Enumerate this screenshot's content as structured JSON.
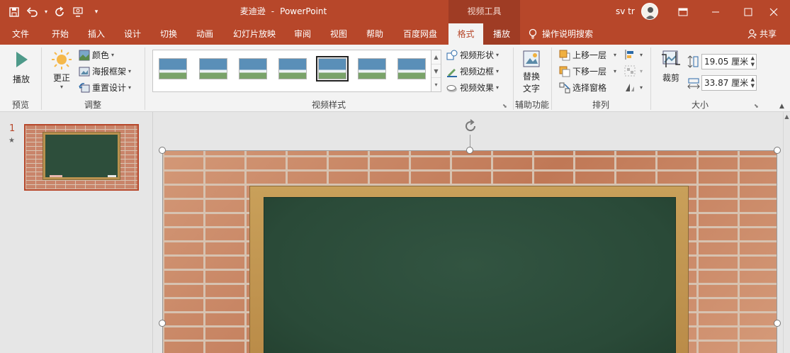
{
  "titlebar": {
    "filename": "麦迪逊",
    "separator": "-",
    "app": "PowerPoint",
    "context_header": "视频工具",
    "user": "sv tr",
    "qat": {
      "save": "save-icon",
      "undo": "undo-icon",
      "redo": "redo-icon",
      "touch": "touch-mode-icon",
      "customize": "customize-qat-icon"
    }
  },
  "tabs": [
    "文件",
    "开始",
    "插入",
    "设计",
    "切换",
    "动画",
    "幻灯片放映",
    "审阅",
    "视图",
    "帮助",
    "百度网盘",
    "格式",
    "播放"
  ],
  "active_tab": "格式",
  "tell_me": "操作说明搜索",
  "share": "共享",
  "ribbon": {
    "preview": {
      "play": "播放",
      "label": "预览"
    },
    "adjust": {
      "corrections": "更正",
      "color": "颜色",
      "poster_frame": "海报框架",
      "reset_design": "重置设计",
      "label": "调整"
    },
    "styles": {
      "label": "视频样式",
      "video_shape": "视频形状",
      "video_border": "视频边框",
      "video_effects": "视频效果"
    },
    "accessibility": {
      "alt_text_1": "替换",
      "alt_text_2": "文字",
      "label": "辅助功能"
    },
    "arrange": {
      "bring_forward": "上移一层",
      "send_backward": "下移一层",
      "selection_pane": "选择窗格",
      "label": "排列"
    },
    "size": {
      "crop": "裁剪",
      "height": "19.05 厘米",
      "width": "33.87 厘米",
      "label": "大小"
    }
  },
  "slides": {
    "number": "1",
    "star": "★"
  }
}
